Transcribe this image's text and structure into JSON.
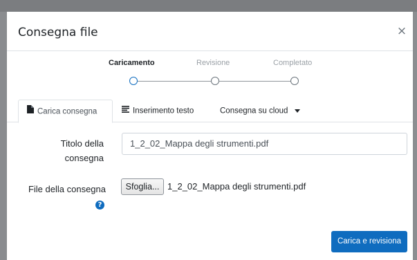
{
  "modal": {
    "title": "Consegna file",
    "close_glyph": "×",
    "close_icon": "close-icon"
  },
  "stepper": {
    "steps": [
      {
        "label": "Caricamento",
        "active": true
      },
      {
        "label": "Revisione",
        "active": false
      },
      {
        "label": "Completato",
        "active": false
      }
    ]
  },
  "tabs": [
    {
      "label": "Carica consegna",
      "icon": "file-icon",
      "active": true
    },
    {
      "label": "Inserimento testo",
      "icon": "text-lines-icon",
      "active": false
    },
    {
      "label": "Consegna su cloud",
      "icon": "caret-down-icon",
      "active": false
    }
  ],
  "form": {
    "title_label": "Titolo della consegna",
    "title_value": "1_2_02_Mappa degli strumenti.pdf",
    "file_label": "File della consegna",
    "help_glyph": "?",
    "browse_label": "Sfoglia...",
    "file_name": "1_2_02_Mappa degli strumenti.pdf"
  },
  "footer": {
    "submit_label": "Carica e revisiona"
  },
  "colors": {
    "accent": "#0f6cbf",
    "border": "#dee2e6",
    "muted_text": "#9aa0a6"
  }
}
